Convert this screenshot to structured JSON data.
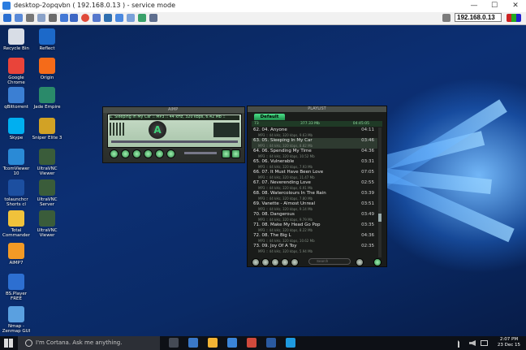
{
  "viewer": {
    "title": "desktop-2opqvbn ( 192.168.0.13 ) - service mode",
    "address": "192.168.0.13",
    "minimize": "—",
    "maximize": "☐",
    "close": "✕"
  },
  "desktop_icons": [
    {
      "label": "Recycle Bin",
      "icon": "recycle-bin-icon",
      "color": "#d8dde6"
    },
    {
      "label": "Google Chrome",
      "icon": "chrome-icon",
      "color": "#e9443a"
    },
    {
      "label": "qBittorrent",
      "icon": "qbittorrent-icon",
      "color": "#3b7fd3"
    },
    {
      "label": "Skype",
      "icon": "skype-icon",
      "color": "#00aff0"
    },
    {
      "label": "TcomViewer 10",
      "icon": "tcomviewer-icon",
      "color": "#2a8ad6"
    },
    {
      "label": "tolaunchcr Shorts cl",
      "icon": "launcher-icon",
      "color": "#1c4fa0"
    },
    {
      "label": "Total Commander",
      "icon": "total-commander-icon",
      "color": "#f0c23b"
    },
    {
      "label": "AIMP7",
      "icon": "aimp-icon",
      "color": "#f39a25"
    },
    {
      "label": "BS.Player FREE",
      "icon": "bsplayer-icon",
      "color": "#2d6fd1"
    },
    {
      "label": "Nmap - Zenmap GUI",
      "icon": "nmap-icon",
      "color": "#5aa0e0"
    },
    {
      "label": "Reflect",
      "icon": "reflect-icon",
      "color": "#1c69c9"
    },
    {
      "label": "Origin",
      "icon": "origin-icon",
      "color": "#f56b19"
    },
    {
      "label": "Jade Empire",
      "icon": "jade-empire-icon",
      "color": "#2a8a6a"
    },
    {
      "label": "Sniper Elite 3",
      "icon": "sniper-elite-icon",
      "color": "#d2a225"
    },
    {
      "label": "UltraVNC Viewer",
      "icon": "ultravnc-viewer-icon",
      "color": "#3a5c3a"
    },
    {
      "label": "UltraVNC Server",
      "icon": "ultravnc-server-icon",
      "color": "#3a5c3a"
    },
    {
      "label": "UltraVNC Viewer",
      "icon": "ultravnc-viewer-icon",
      "color": "#3a5c3a"
    }
  ],
  "aimp": {
    "title": "AIMP",
    "now_playing": "1. Sleeping In My Car :: MP3 :: 44 kHz, 320 kbps, 6.42 Mb ::",
    "logo": "A",
    "accent": "#3fd27a"
  },
  "playlist": {
    "title": "PLAYLIST",
    "tab": "Default",
    "header_left": "73",
    "header_right": "377.33 Mb",
    "header_time": "04:45:05",
    "search_placeholder": "Search",
    "rows": [
      {
        "title": "62. 04. Anyone",
        "meta": "MP3 :: 44 kHz, 320 kbps, 9.63 Mb",
        "dur": "04:11",
        "sel": false
      },
      {
        "title": "63. 05. Sleeping In My Car",
        "meta": "MP3 :: 44 kHz, 320 kbps, 8.82 Mb",
        "dur": "03:46",
        "sel": true
      },
      {
        "title": "64. 06. Spending My Time",
        "meta": "MP3 :: 44 kHz, 320 kbps, 10.52 Mb",
        "dur": "04:36",
        "sel": false
      },
      {
        "title": "65. 06. Vulnerable",
        "meta": "MP3 :: 44 kHz, 320 kbps, 7.93 Mb",
        "dur": "03:31",
        "sel": false
      },
      {
        "title": "66. 07. It Must Have Been Love",
        "meta": "MP3 :: 44 kHz, 320 kbps, 11.47 Mb",
        "dur": "07:05",
        "sel": false
      },
      {
        "title": "67. 07. Neverending Love",
        "meta": "MP3 :: 44 kHz, 320 kbps, 6.91 Mb",
        "dur": "02:55",
        "sel": false
      },
      {
        "title": "68. 08. Watercolours In The Rain",
        "meta": "MP3 :: 44 kHz, 320 kbps, 7.80 Mb",
        "dur": "03:39",
        "sel": false
      },
      {
        "title": "69. Vanette - Almost Unreal",
        "meta": "MP3 :: 44 kHz, 320 kbps, 9.14 Mb",
        "dur": "03:51",
        "sel": false
      },
      {
        "title": "70. 08. Dangerous",
        "meta": "MP3 :: 44 kHz, 320 kbps, 9.79 Mb",
        "dur": "03:49",
        "sel": false
      },
      {
        "title": "71. 08. Make My Head Go Pop",
        "meta": "MP3 :: 44 kHz, 320 kbps, 8.22 Mb",
        "dur": "03:35",
        "sel": false
      },
      {
        "title": "72. 08. The Big L",
        "meta": "MP3 :: 44 kHz, 320 kbps, 10.62 Mb",
        "dur": "04:36",
        "sel": false
      },
      {
        "title": "73. 09. Joy Of A Toy",
        "meta": "MP3 :: 44 kHz, 320 kbps, 5.94 Mb",
        "dur": "02:35",
        "sel": false
      }
    ]
  },
  "taskbar": {
    "cortana_placeholder": "I'm Cortana. Ask me anything.",
    "time": "2:07 PM",
    "date": "23 Dec 15"
  }
}
